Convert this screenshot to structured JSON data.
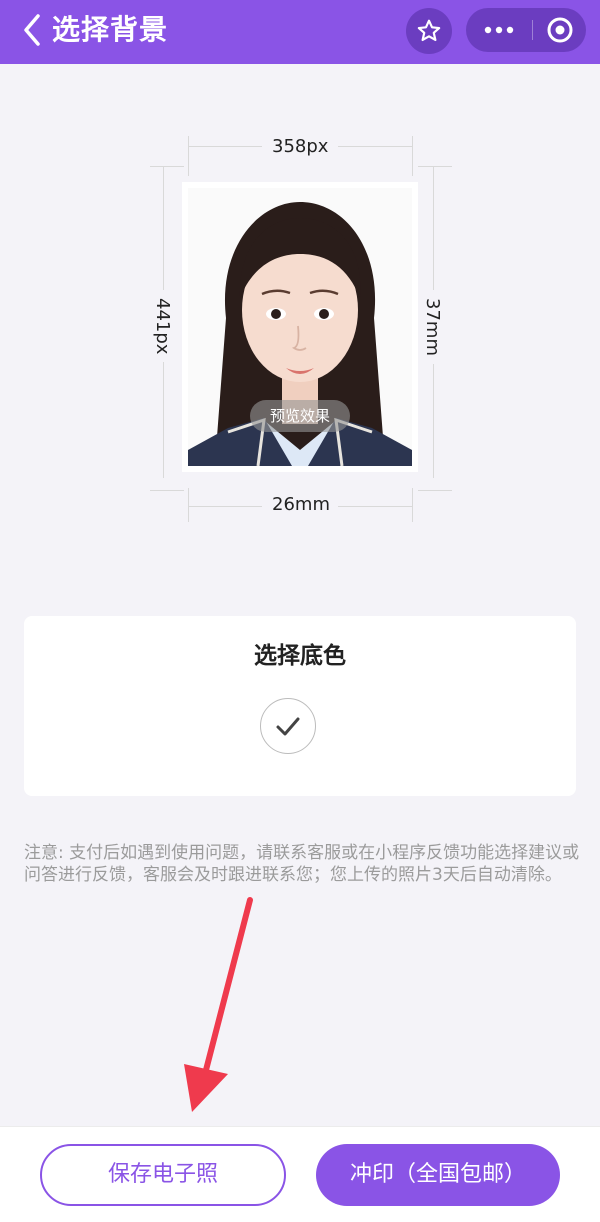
{
  "header": {
    "title": "选择背景",
    "back_icon": "chevron-left-icon",
    "favorite_icon": "star-icon",
    "more_icon": "more-dots-icon",
    "close_icon": "target-circle-icon",
    "bg_color": "#8a54e6"
  },
  "preview": {
    "width_px": "358px",
    "height_px": "441px",
    "height_mm": "37mm",
    "width_mm": "26mm",
    "preview_label": "预览效果"
  },
  "color_picker": {
    "title": "选择底色",
    "selected_swatch": "white",
    "check_icon": "checkmark-icon"
  },
  "note": {
    "text": "注意: 支付后如遇到使用问题，请联系客服或在小程序反馈功能选择建议或问答进行反馈，客服会及时跟进联系您；您上传的照片3天后自动清除。"
  },
  "actions": {
    "save_label": "保存电子照",
    "print_label": "冲印（全国包邮）",
    "accent_color": "#8a54e6"
  },
  "annotation": {
    "arrow_color": "#ef3a4d"
  }
}
